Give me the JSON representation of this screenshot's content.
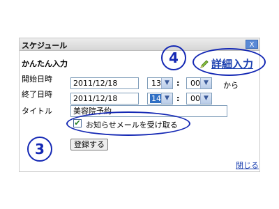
{
  "dialog": {
    "title": "スケジュール",
    "close_label": "X",
    "quick_input_label": "かんたん入力",
    "detail_link": "詳細入力",
    "start_label": "開始日時",
    "end_label": "終了日時",
    "title_label": "タイトル",
    "start_date": "2011/12/18",
    "start_hour": "13",
    "start_minute": "00",
    "from_label": "から",
    "end_date": "2011/12/18",
    "end_hour": "14",
    "end_minute": "00",
    "title_value": "美容院予約",
    "notify_label": "お知らせメールを受け取る",
    "notify_checked": true,
    "register_button": "登録する",
    "close_link": "閉じる",
    "colon": ":"
  },
  "annotations": {
    "marker_3": "3",
    "marker_4": "4",
    "marker_color": "#1428b4"
  },
  "icons": {
    "pencil": "pencil-icon",
    "dropdown": "chevron-down-icon",
    "check": "check-icon"
  }
}
